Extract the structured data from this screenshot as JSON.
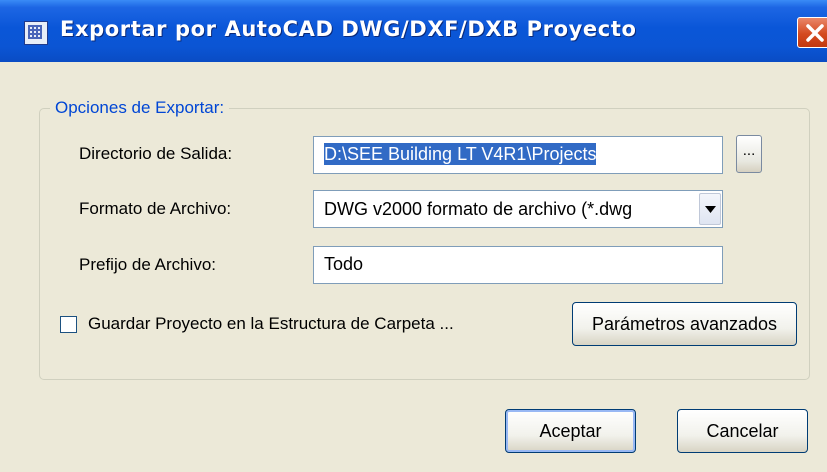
{
  "window": {
    "title": "Exportar por AutoCAD DWG/DXF/DXB Proyecto",
    "title_icon": "app-window-icon",
    "close_icon": "close-icon"
  },
  "group": {
    "legend": "Opciones de Exportar:"
  },
  "fields": {
    "output_dir_label": "Directorio de Salida:",
    "output_dir_value": "D:\\SEE Building LT V4R1\\Projects",
    "browse_label": "...",
    "format_label": "Formato de Archivo:",
    "format_value": "DWG v2000 formato de archivo (*.dwg",
    "prefix_label": "Prefijo de Archivo:",
    "prefix_value": "Todo"
  },
  "options": {
    "save_structure_label": "Guardar Proyecto en la Estructura de Carpeta ...",
    "save_structure_checked": false,
    "advanced_button": "Parámetros avanzados"
  },
  "buttons": {
    "accept": "Aceptar",
    "cancel": "Cancelar"
  },
  "colors": {
    "titlebar": "#0a56d8",
    "dialog_bg": "#ece9d8",
    "legend_text": "#0046d5",
    "selection": "#316ac5",
    "close_button": "#d44a20"
  }
}
